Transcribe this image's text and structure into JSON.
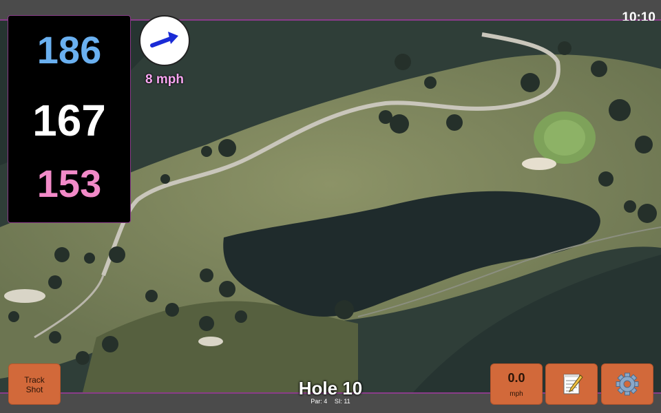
{
  "clock": {
    "time": "10:10"
  },
  "distances": {
    "back": "186",
    "middle": "167",
    "front": "153"
  },
  "wind": {
    "speed": "8 mph",
    "direction_icon": "wind-arrow-icon"
  },
  "hole": {
    "title": "Hole 10",
    "par": "Par: 4",
    "stroke_index": "SI: 11"
  },
  "buttons": {
    "track_shot_line1": "Track",
    "track_shot_line2": "Shot",
    "speed_value": "0.0",
    "speed_unit": "mph",
    "notes_icon": "notepad-icon",
    "settings_icon": "gear-icon"
  },
  "colors": {
    "back_distance": "#6ab0f0",
    "middle_distance": "#ffffff",
    "front_distance": "#f28ac8",
    "wind_text": "#f7a6f0",
    "button": "#d2693a",
    "accent_border": "#8a3c8a"
  }
}
